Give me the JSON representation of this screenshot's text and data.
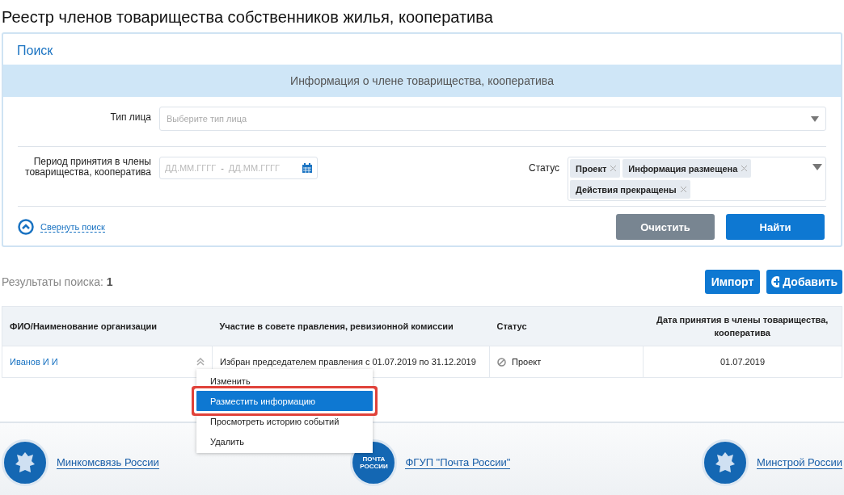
{
  "page_title": "Реестр членов товарищества собственников жилья, кооператива",
  "search": {
    "title": "Поиск",
    "section_header": "Информация о члене товарищества, кооператива",
    "person_type": {
      "label": "Тип лица",
      "placeholder": "Выберите тип лица"
    },
    "period": {
      "label": "Период принятия в члены товарищества, кооператива",
      "from_placeholder": "ДД.ММ.ГГГГ",
      "separator": "-",
      "to_placeholder": "ДД.ММ.ГГГГ"
    },
    "status_filter": {
      "label": "Статус",
      "tags": [
        "Проект",
        "Информация размещена",
        "Действия прекращены"
      ]
    },
    "collapse_link": "Свернуть поиск",
    "buttons": [
      {
        "label": "Очистить",
        "kind": "secondary"
      },
      {
        "label": "Найти",
        "kind": "primary"
      }
    ]
  },
  "results": {
    "label": "Результаты поиска:",
    "count": "1"
  },
  "actions": [
    {
      "label": "Импорт",
      "kind": "plain"
    },
    {
      "label": "Добавить",
      "kind": "add"
    }
  ],
  "table": {
    "columns": [
      "ФИО/Наименование организации",
      "Участие в совете правления, ревизионной комиссии",
      "Статус",
      "Дата принятия в члены товарищества, кооператива"
    ],
    "rows": [
      {
        "name": "Иванов И И",
        "participation": "Избран председателем правления с 01.07.2019 по 31.12.2019",
        "status": "Проект",
        "date": "01.07.2019"
      }
    ]
  },
  "context_menu": [
    {
      "label": "Изменить",
      "selected": false
    },
    {
      "label": "Разместить информацию",
      "selected": true
    },
    {
      "label": "Просмотреть историю событий",
      "selected": false
    },
    {
      "label": "Удалить",
      "selected": false
    }
  ],
  "footer": [
    {
      "label": "Минкомсвязь России",
      "kind": "emblem"
    },
    {
      "label": "ФГУП \"Почта России\"",
      "kind": "post",
      "logo_text": [
        "ПОЧТА",
        "РОССИИ"
      ]
    },
    {
      "label": "Минстрой России",
      "kind": "emblem"
    }
  ]
}
